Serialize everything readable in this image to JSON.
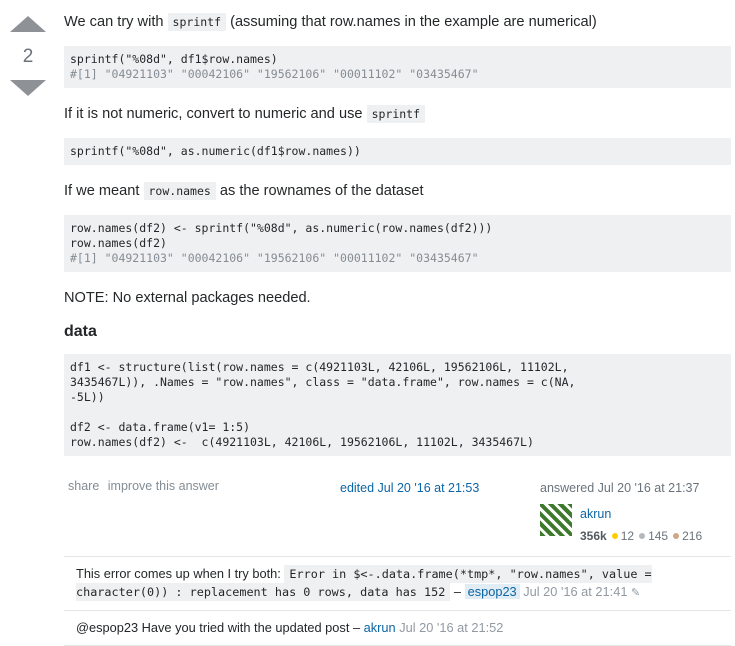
{
  "vote": {
    "count": "2"
  },
  "answer": {
    "intro_text": "We can try with",
    "intro_code": "sprintf",
    "intro_tail": "(assuming that row.names in the example are numerical)",
    "code1": [
      "sprintf(\"%08d\", df1$row.names)",
      "#[1] \"04921103\" \"00042106\" \"19562106\" \"00011102\" \"03435467\""
    ],
    "p2_text": "If it is not numeric, convert to numeric and use",
    "p2_code": "sprintf",
    "code2": "sprintf(\"%08d\", as.numeric(df1$row.names))",
    "p3_text": "If we meant",
    "p3_code": "row.names",
    "p3_tail": "as the rownames of the dataset",
    "code3": [
      "row.names(df2) <- sprintf(\"%08d\", as.numeric(row.names(df2)))",
      "row.names(df2)",
      "#[1] \"04921103\" \"00042106\" \"19562106\" \"00011102\" \"03435467\""
    ],
    "note": "NOTE: No external packages needed.",
    "data_heading": "data",
    "code4": [
      "df1 <- structure(list(row.names = c(4921103L, 42106L, 19562106L, 11102L,",
      "3435467L)), .Names = \"row.names\", class = \"data.frame\", row.names = c(NA,",
      "-5L))",
      "",
      "df2 <- data.frame(v1= 1:5)",
      "row.names(df2) <-  c(4921103L, 42106L, 19562106L, 11102L, 3435467L)"
    ]
  },
  "post_menu": {
    "share": "share",
    "improve": "improve this answer"
  },
  "edited": "edited Jul 20 '16 at 21:53",
  "user": {
    "answered": "answered Jul 20 '16 at 21:37",
    "name": "akrun",
    "rep": "356k",
    "gold": "12",
    "silver": "145",
    "bronze": "216"
  },
  "colors": {
    "gold": "#ffcc01",
    "silver": "#b4b8bc",
    "bronze": "#d1a684"
  },
  "comments": [
    {
      "text_before": "This error comes up when I try both:",
      "code": "Error in $<-.data.frame(*tmp*, \"row.names\", value = character(0)) : replacement has 0 rows, data has 152",
      "dash": "–",
      "user": "espop23",
      "date": "Jul 20 '16 at 21:41"
    },
    {
      "text_before": "@espop23 Have you tried with the updated post",
      "dash": "–",
      "user": "akrun",
      "date": "Jul 20 '16 at 21:52"
    }
  ]
}
